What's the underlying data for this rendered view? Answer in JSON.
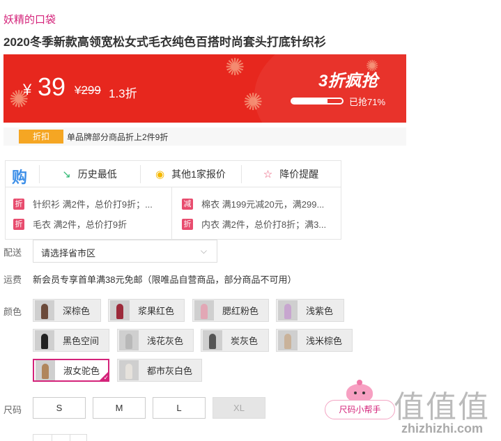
{
  "brand": "妖精的口袋",
  "title": "2020冬季新款高领宽松女式毛衣纯色百搭时尚套头打底针织衫",
  "price": {
    "currency": "¥",
    "current": "39",
    "original": "¥299",
    "discount": "1.3折",
    "sale_title": "3折疯抢",
    "sold_text": "已抢71%",
    "sold_fraction": 0.71
  },
  "promo_strip": {
    "badge": "折扣",
    "text": "单品牌部分商品折上2件9折"
  },
  "tools": {
    "logo_char": "购",
    "history_low": "历史最低",
    "other_quotes": "其他1家报价",
    "price_alert": "降价提醒",
    "promos": [
      {
        "tag": "折",
        "text": "针织衫 满2件，总价打9折；..."
      },
      {
        "tag": "减",
        "text": "棉衣 满199元减20元，满299..."
      },
      {
        "tag": "折",
        "text": "毛衣 满2件，总价打9折"
      },
      {
        "tag": "折",
        "text": "内衣 满2件，总价打8折；满3..."
      }
    ]
  },
  "delivery": {
    "label": "配送",
    "placeholder": "请选择省市区"
  },
  "shipping": {
    "label": "运费",
    "text": "新会员专享首单满38元免邮（限唯品自营商品，部分商品不可用）"
  },
  "colors": {
    "label": "颜色",
    "options": [
      {
        "name": "深棕色",
        "swatch": "#6b4a3a"
      },
      {
        "name": "浆果红色",
        "swatch": "#9c2a3a"
      },
      {
        "name": "腮红粉色",
        "swatch": "#e2a7b5"
      },
      {
        "name": "浅紫色",
        "swatch": "#c7a6cf"
      },
      {
        "name": "黑色空间",
        "swatch": "#222222"
      },
      {
        "name": "浅花灰色",
        "swatch": "#b8b8b8"
      },
      {
        "name": "炭灰色",
        "swatch": "#555555"
      },
      {
        "name": "浅米棕色",
        "swatch": "#c9b29a"
      },
      {
        "name": "淑女驼色",
        "swatch": "#b0865c"
      },
      {
        "name": "都市灰白色",
        "swatch": "#e6e2dc"
      }
    ],
    "selected": "淑女驼色"
  },
  "sizes": {
    "label": "尺码",
    "options": [
      "S",
      "M",
      "L",
      "XL"
    ],
    "disabled": [
      "XL"
    ]
  },
  "size_helper": "尺码小帮手",
  "watermark": {
    "glyphs": "值值值",
    "site": "zhizhizhi.com"
  }
}
